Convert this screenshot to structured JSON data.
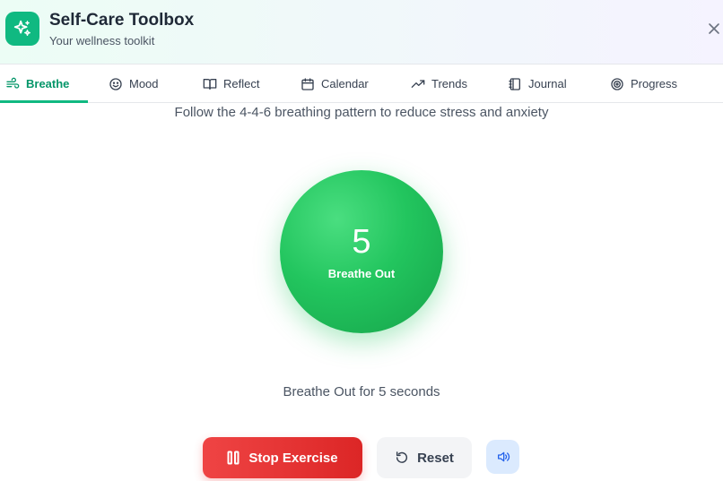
{
  "header": {
    "title": "Self-Care Toolbox",
    "subtitle": "Your wellness toolkit",
    "app_icon": "sparkles-icon",
    "close_icon": "close-icon"
  },
  "tabs": [
    {
      "label": "Breathe",
      "icon": "wind-icon",
      "active": true
    },
    {
      "label": "Mood",
      "icon": "smile-icon",
      "active": false
    },
    {
      "label": "Reflect",
      "icon": "book-open-icon",
      "active": false
    },
    {
      "label": "Calendar",
      "icon": "calendar-icon",
      "active": false
    },
    {
      "label": "Trends",
      "icon": "trending-up-icon",
      "active": false
    },
    {
      "label": "Journal",
      "icon": "notebook-icon",
      "active": false
    },
    {
      "label": "Progress",
      "icon": "target-icon",
      "active": false
    }
  ],
  "breathe": {
    "instruction": "Follow the 4-4-6 breathing pattern to reduce stress and anxiety",
    "count": "5",
    "phase": "Breathe Out",
    "status": "Breathe Out for 5 seconds"
  },
  "controls": {
    "stop_label": "Stop Exercise",
    "reset_label": "Reset",
    "sound_icon": "volume-icon"
  },
  "colors": {
    "accent": "#10b981",
    "stop": "#ef4444",
    "circle": "#22c55e",
    "sound_bg": "#dbeafe"
  }
}
